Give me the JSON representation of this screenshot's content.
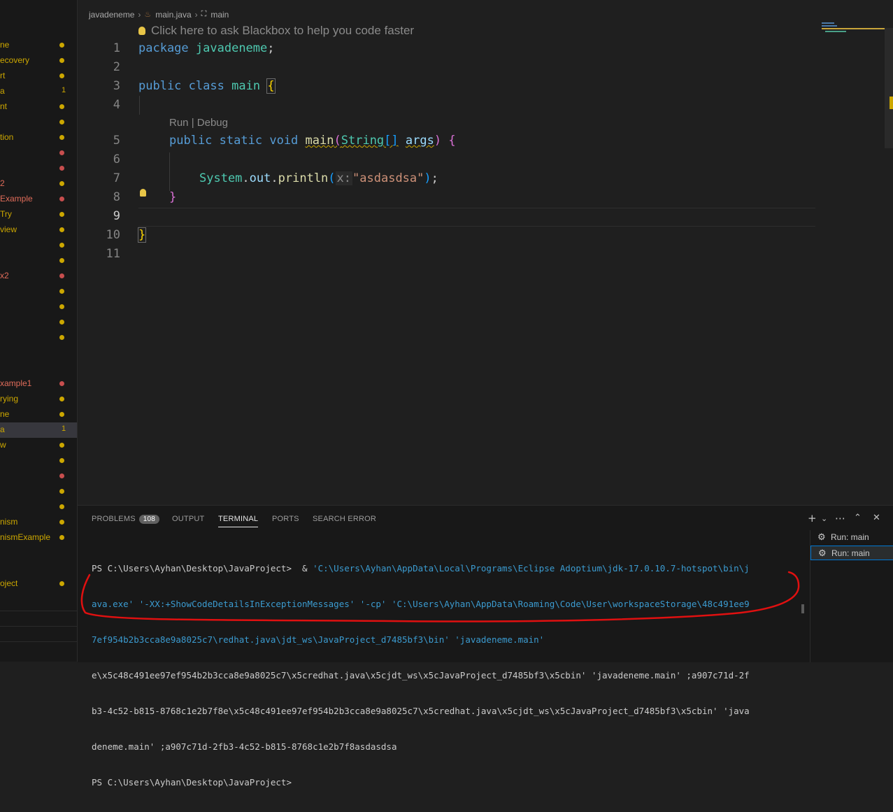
{
  "sidebar": {
    "items": [
      {
        "label": "ne",
        "color": "#cca700",
        "dot": "#cca700",
        "badge": ""
      },
      {
        "label": "ecovery",
        "color": "#cca700",
        "dot": "#cca700",
        "badge": ""
      },
      {
        "label": "rt",
        "color": "#cca700",
        "dot": "#cca700",
        "badge": ""
      },
      {
        "label": "a",
        "color": "#cca700",
        "dot": "",
        "badge": "1"
      },
      {
        "label": "nt",
        "color": "#cca700",
        "dot": "#cca700",
        "badge": ""
      },
      {
        "label": "",
        "color": "#cca700",
        "dot": "#cca700",
        "badge": ""
      },
      {
        "label": "tion",
        "color": "#cca700",
        "dot": "#cca700",
        "badge": ""
      },
      {
        "label": "",
        "color": "#cca700",
        "dot": "#c74e4e",
        "badge": ""
      },
      {
        "label": "",
        "color": "#cca700",
        "dot": "#c74e4e",
        "badge": ""
      },
      {
        "label": "2",
        "color": "#e06c5a",
        "dot": "#cca700",
        "badge": ""
      },
      {
        "label": "Example",
        "color": "#e06c5a",
        "dot": "#c74e4e",
        "badge": ""
      },
      {
        "label": "Try",
        "color": "#cca700",
        "dot": "#cca700",
        "badge": ""
      },
      {
        "label": "view",
        "color": "#cca700",
        "dot": "#cca700",
        "badge": ""
      },
      {
        "label": "",
        "color": "#cca700",
        "dot": "#cca700",
        "badge": ""
      },
      {
        "label": "",
        "color": "#cca700",
        "dot": "#cca700",
        "badge": ""
      },
      {
        "label": "x2",
        "color": "#e06c5a",
        "dot": "#c74e4e",
        "badge": ""
      },
      {
        "label": "",
        "color": "#cca700",
        "dot": "#cca700",
        "badge": ""
      },
      {
        "label": "",
        "color": "#cca700",
        "dot": "#cca700",
        "badge": ""
      },
      {
        "label": "",
        "color": "#cca700",
        "dot": "#cca700",
        "badge": ""
      },
      {
        "label": "",
        "color": "#cca700",
        "dot": "#cca700",
        "badge": ""
      },
      {
        "label": "",
        "color": "#cca700",
        "dot": "",
        "badge": ""
      },
      {
        "label": "",
        "color": "#cca700",
        "dot": "",
        "badge": ""
      },
      {
        "label": "xample1",
        "color": "#e06c5a",
        "dot": "#c74e4e",
        "badge": ""
      },
      {
        "label": "rying",
        "color": "#cca700",
        "dot": "#cca700",
        "badge": ""
      },
      {
        "label": "ne",
        "color": "#cca700",
        "dot": "#cca700",
        "badge": ""
      },
      {
        "label": "a",
        "color": "#cca700",
        "dot": "",
        "badge": "1",
        "selected": true
      },
      {
        "label": "w",
        "color": "#cca700",
        "dot": "#cca700",
        "badge": ""
      },
      {
        "label": "",
        "color": "#cca700",
        "dot": "#cca700",
        "badge": ""
      },
      {
        "label": "",
        "color": "#cca700",
        "dot": "#c74e4e",
        "badge": ""
      },
      {
        "label": "",
        "color": "#cca700",
        "dot": "#cca700",
        "badge": ""
      },
      {
        "label": "",
        "color": "#cca700",
        "dot": "#cca700",
        "badge": ""
      },
      {
        "label": "nism",
        "color": "#cca700",
        "dot": "#cca700",
        "badge": ""
      },
      {
        "label": "nismExample",
        "color": "#cca700",
        "dot": "#cca700",
        "badge": ""
      },
      {
        "label": "",
        "color": "#cca700",
        "dot": "",
        "badge": ""
      },
      {
        "label": "",
        "color": "#cca700",
        "dot": "",
        "badge": ""
      },
      {
        "label": "oject",
        "color": "#cca700",
        "dot": "#cca700",
        "badge": ""
      }
    ]
  },
  "breadcrumb": {
    "project": "javadeneme",
    "file": "main.java",
    "symbol": "main"
  },
  "hint": "Click here to ask Blackbox to help you code faster",
  "codelens": {
    "run": "Run",
    "sep": " | ",
    "debug": "Debug"
  },
  "code": {
    "line_numbers": [
      "1",
      "2",
      "3",
      "4",
      "5",
      "6",
      "7",
      "8",
      "9",
      "10",
      "11"
    ],
    "l1_kw": "package",
    "l1_pkg": "javadeneme",
    "l1_end": ";",
    "l3_kw1": "public",
    "l3_kw2": "class",
    "l3_cls": "main",
    "l3_brace": "{",
    "l5_kw1": "public",
    "l5_kw2": "static",
    "l5_kw3": "void",
    "l5_fn": "main",
    "l5_p1": "(",
    "l5_type": "String",
    "l5_arr": "[]",
    "l5_arg": "args",
    "l5_p2": ")",
    "l5_brace": "{",
    "l7_cls": "System",
    "l7_dot1": ".",
    "l7_out": "out",
    "l7_dot2": ".",
    "l7_fn": "println",
    "l7_p1": "(",
    "l7_hint": "x:",
    "l7_str": "\"asdasdsa\"",
    "l7_p2": ")",
    "l7_end": ";",
    "l8_brace": "}",
    "l10_brace": "}"
  },
  "panel": {
    "tabs": {
      "problems": "PROBLEMS",
      "problems_count": "108",
      "output": "OUTPUT",
      "terminal": "TERMINAL",
      "ports": "PORTS",
      "search_error": "SEARCH ERROR"
    },
    "terminal": {
      "l1a": "PS C:\\Users\\Ayhan\\Desktop\\JavaProject>  & ",
      "l1b": "'C:\\Users\\Ayhan\\AppData\\Local\\Programs\\Eclipse Adoptium\\jdk-17.0.10.7-hotspot\\bin\\j",
      "l2": "ava.exe' '-XX:+ShowCodeDetailsInExceptionMessages' '-cp' 'C:\\Users\\Ayhan\\AppData\\Roaming\\Code\\User\\workspaceStorage\\48c491ee9",
      "l3": "7ef954b2b3cca8e9a8025c7\\redhat.java\\jdt_ws\\JavaProject_d7485bf3\\bin' 'javadeneme.main'",
      "l4": "e\\x5c48c491ee97ef954b2b3cca8e9a8025c7\\x5credhat.java\\x5cjdt_ws\\x5cJavaProject_d7485bf3\\x5cbin' 'javadeneme.main' ;a907c71d-2f",
      "l5": "b3-4c52-b815-8768c1e2b7f8e\\x5c48c491ee97ef954b2b3cca8e9a8025c7\\x5credhat.java\\x5cjdt_ws\\x5cJavaProject_d7485bf3\\x5cbin' 'java",
      "l6": "deneme.main' ;a907c71d-2fb3-4c52-b815-8768c1e2b7f8asdasdsa",
      "l7": "PS C:\\Users\\Ayhan\\Desktop\\JavaProject>"
    },
    "terminal_list": [
      "Run: main",
      "Run: main"
    ]
  }
}
